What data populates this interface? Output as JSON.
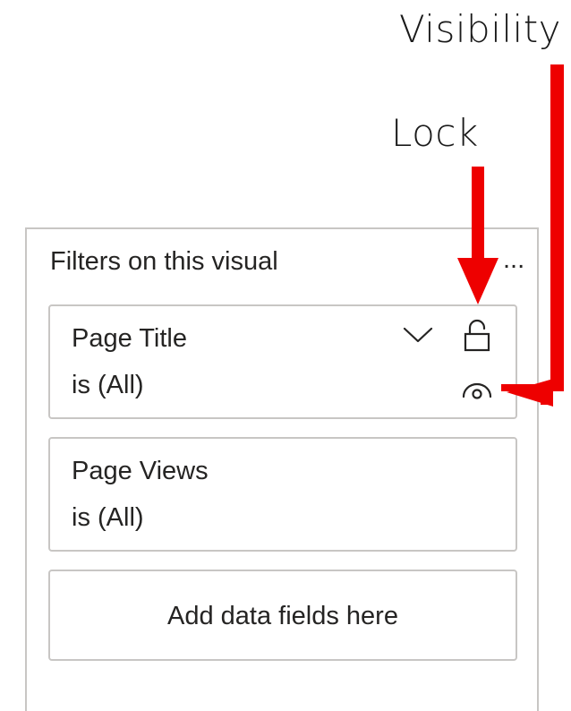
{
  "annotations": {
    "visibility_label": "Visibility",
    "lock_label": "Lock",
    "arrow_color": "#ee0000"
  },
  "filters_pane": {
    "header": "Filters on this visual",
    "more_options": "..."
  },
  "filter_cards": [
    {
      "field": "Page Title",
      "condition": "is (All)",
      "icons": [
        "chevron-down-icon",
        "lock-icon",
        "eye-icon"
      ]
    },
    {
      "field": "Page Views",
      "condition": "is (All)"
    }
  ],
  "drop_zone": {
    "label": "Add data fields here"
  }
}
